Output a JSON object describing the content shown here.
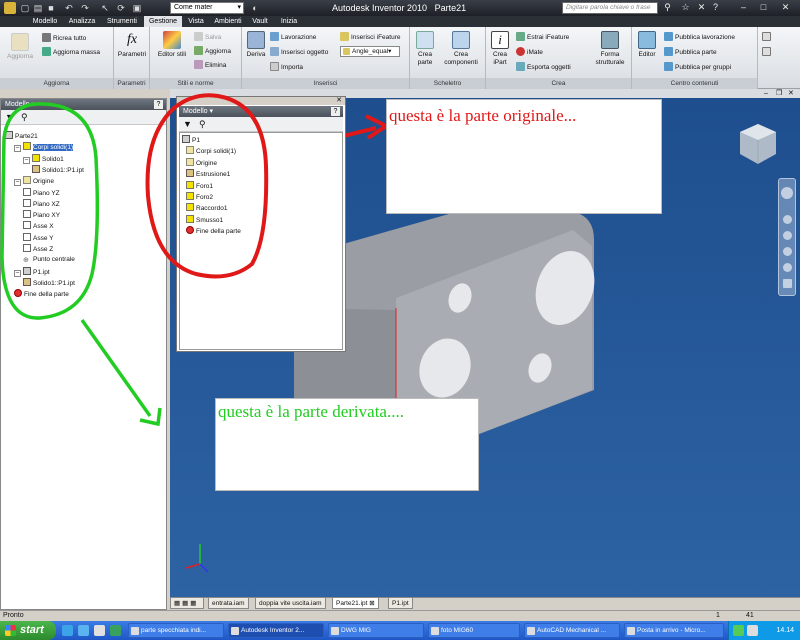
{
  "window": {
    "app_title": "Autodesk Inventor 2010",
    "doc_title": "Parte21",
    "material": "Come mater",
    "search_placeholder": "Digitare parola chiave o frase"
  },
  "tabs": [
    "Modello",
    "Analizza",
    "Strumenti",
    "Gestione",
    "Vista",
    "Ambienti",
    "Vault",
    "Inizia"
  ],
  "active_tab": "Gestione",
  "ribbon": {
    "aggiorna": {
      "title": "Aggiorna",
      "big": "Aggiorna",
      "ricrea": "Ricrea tutto",
      "massa": "Aggiorna massa"
    },
    "parametri": {
      "title": "Parametri",
      "big": "Parametri"
    },
    "stili": {
      "title": "Stili e norme",
      "editor": "Editor stili",
      "salva": "Salva",
      "aggiorna": "Aggiorna",
      "elimina": "Elimina"
    },
    "inserisci": {
      "title": "Inserisci",
      "deriva": "Deriva",
      "lavorazione": "Lavorazione",
      "ins_oggetto": "Inserisci oggetto",
      "importa": "Importa",
      "ifeature": "Inserisci iFeature",
      "angle": "Angle_equal"
    },
    "scheletro": {
      "title": "Scheletro",
      "crea_parte": "Crea parte",
      "crea_componenti": "Crea componenti"
    },
    "crea": {
      "title": "Crea",
      "crea_ipart": "Crea iPart",
      "estrai": "Estrai iFeature",
      "imate": "iMate",
      "esporta": "Esporta oggetti",
      "forma": "Forma strutturale"
    },
    "contenuti": {
      "title": "Centro contenuti",
      "editor": "Editor",
      "pub_lav": "Pubblica lavorazione",
      "pub_parte": "Pubblica parte",
      "pub_gruppi": "Pubblica per gruppi"
    }
  },
  "left_browser": {
    "title": "Modello",
    "help": "?",
    "tree": [
      {
        "label": "Parte21",
        "level": 0,
        "kind": "part"
      },
      {
        "label": "Corpi solidi(1)",
        "level": 1,
        "kind": "solid",
        "selected": true
      },
      {
        "label": "Solido1",
        "level": 2,
        "kind": "solid"
      },
      {
        "label": "Solido1::P1.ipt",
        "level": 3,
        "kind": "feat"
      },
      {
        "label": "Origine",
        "level": 1,
        "kind": "folder"
      },
      {
        "label": "Piano YZ",
        "level": 2,
        "kind": "plane"
      },
      {
        "label": "Piano XZ",
        "level": 2,
        "kind": "plane"
      },
      {
        "label": "Piano XY",
        "level": 2,
        "kind": "plane"
      },
      {
        "label": "Asse X",
        "level": 2,
        "kind": "axis"
      },
      {
        "label": "Asse Y",
        "level": 2,
        "kind": "axis"
      },
      {
        "label": "Asse Z",
        "level": 2,
        "kind": "axis"
      },
      {
        "label": "Punto centrale",
        "level": 2,
        "kind": "point"
      },
      {
        "label": "P1.ipt",
        "level": 1,
        "kind": "part"
      },
      {
        "label": "Solido1::P1.ipt",
        "level": 2,
        "kind": "feat"
      },
      {
        "label": "Fine della parte",
        "level": 1,
        "kind": "end"
      }
    ]
  },
  "float_browser": {
    "title": "Modello",
    "help": "?",
    "tree": [
      {
        "label": "P1",
        "level": 0,
        "kind": "part"
      },
      {
        "label": "Corpi solidi(1)",
        "level": 1,
        "kind": "folder"
      },
      {
        "label": "Origine",
        "level": 1,
        "kind": "folder"
      },
      {
        "label": "Estrusione1",
        "level": 1,
        "kind": "feat"
      },
      {
        "label": "Foro1",
        "level": 1,
        "kind": "solid"
      },
      {
        "label": "Foro2",
        "level": 1,
        "kind": "solid"
      },
      {
        "label": "Raccordo1",
        "level": 1,
        "kind": "solid"
      },
      {
        "label": "Smusso1",
        "level": 1,
        "kind": "solid"
      },
      {
        "label": "Fine della parte",
        "level": 1,
        "kind": "end"
      }
    ]
  },
  "callouts": {
    "original": "questa è la parte originale...",
    "derived": "questa è la parte derivata...."
  },
  "doc_tabs": [
    "entrata.iam",
    "doppia vite uscita.iam",
    "Parte21.ipt",
    "P1.ipt"
  ],
  "active_doc_tab": "Parte21.ipt",
  "status": {
    "text": "Pronto",
    "num1": "1",
    "num2": "41"
  },
  "taskbar": {
    "start": "start",
    "items": [
      "parte specchiata indi...",
      "Autodesk Inventor 2...",
      "DWG MIG",
      "foto MIG60",
      "AutoCAD Mechanical ...",
      "Posta in arrivo - Micro..."
    ],
    "active": "Autodesk Inventor 2...",
    "clock": "14.14"
  },
  "colors": {
    "annotation_red": "#e01818",
    "annotation_green": "#22cc22",
    "viewport_blue": "#2558a0"
  }
}
